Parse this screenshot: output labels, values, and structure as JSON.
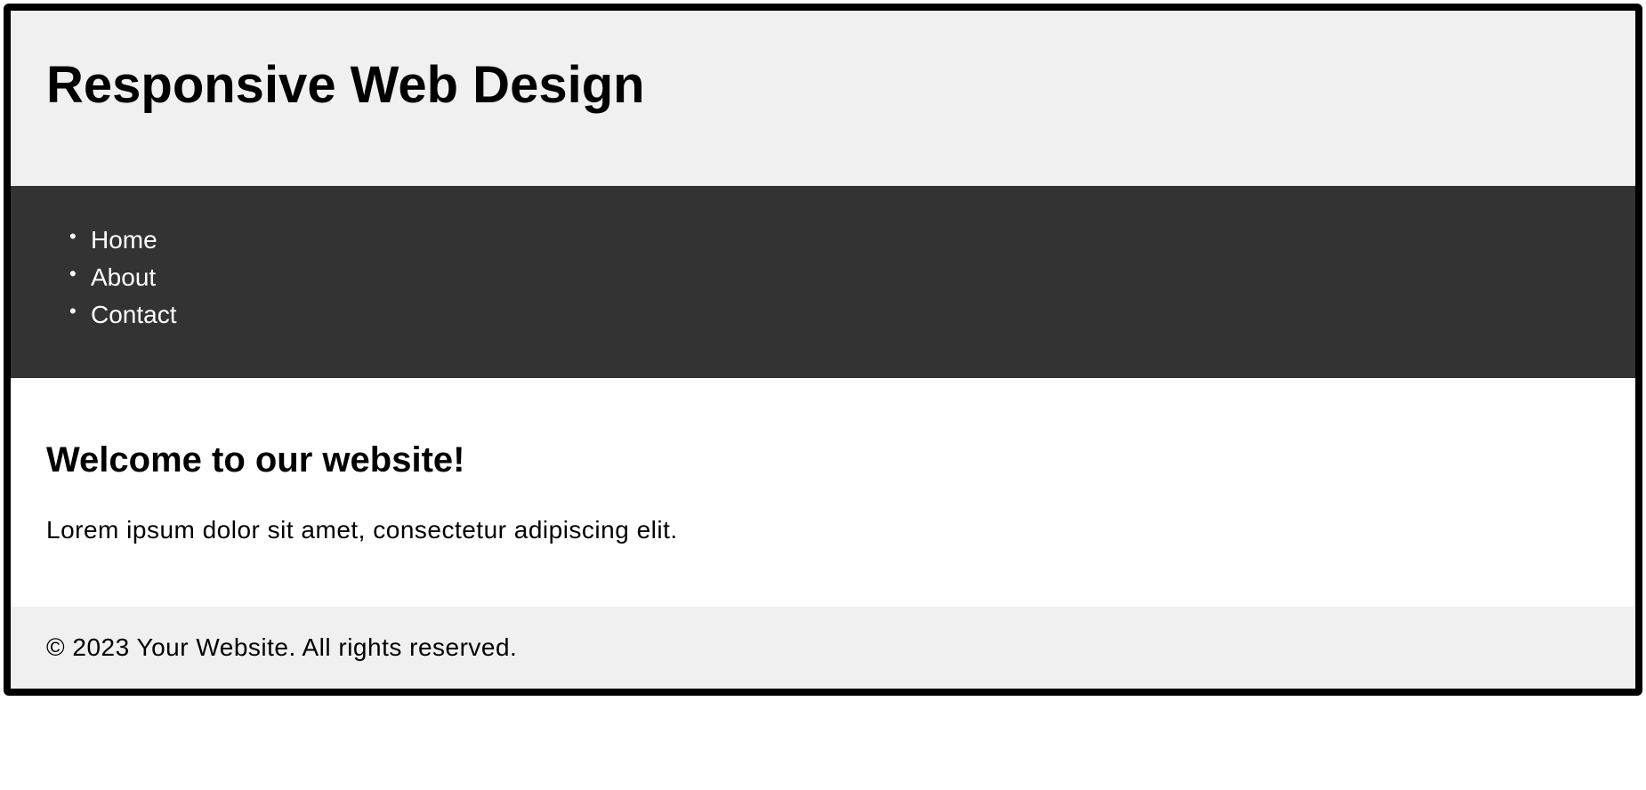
{
  "header": {
    "title": "Responsive Web Design"
  },
  "nav": {
    "items": [
      {
        "label": "Home"
      },
      {
        "label": "About"
      },
      {
        "label": "Contact"
      }
    ]
  },
  "main": {
    "heading": "Welcome to our website!",
    "paragraph": "Lorem ipsum dolor sit amet, consectetur adipiscing elit."
  },
  "footer": {
    "text": "© 2023 Your Website. All rights reserved."
  }
}
